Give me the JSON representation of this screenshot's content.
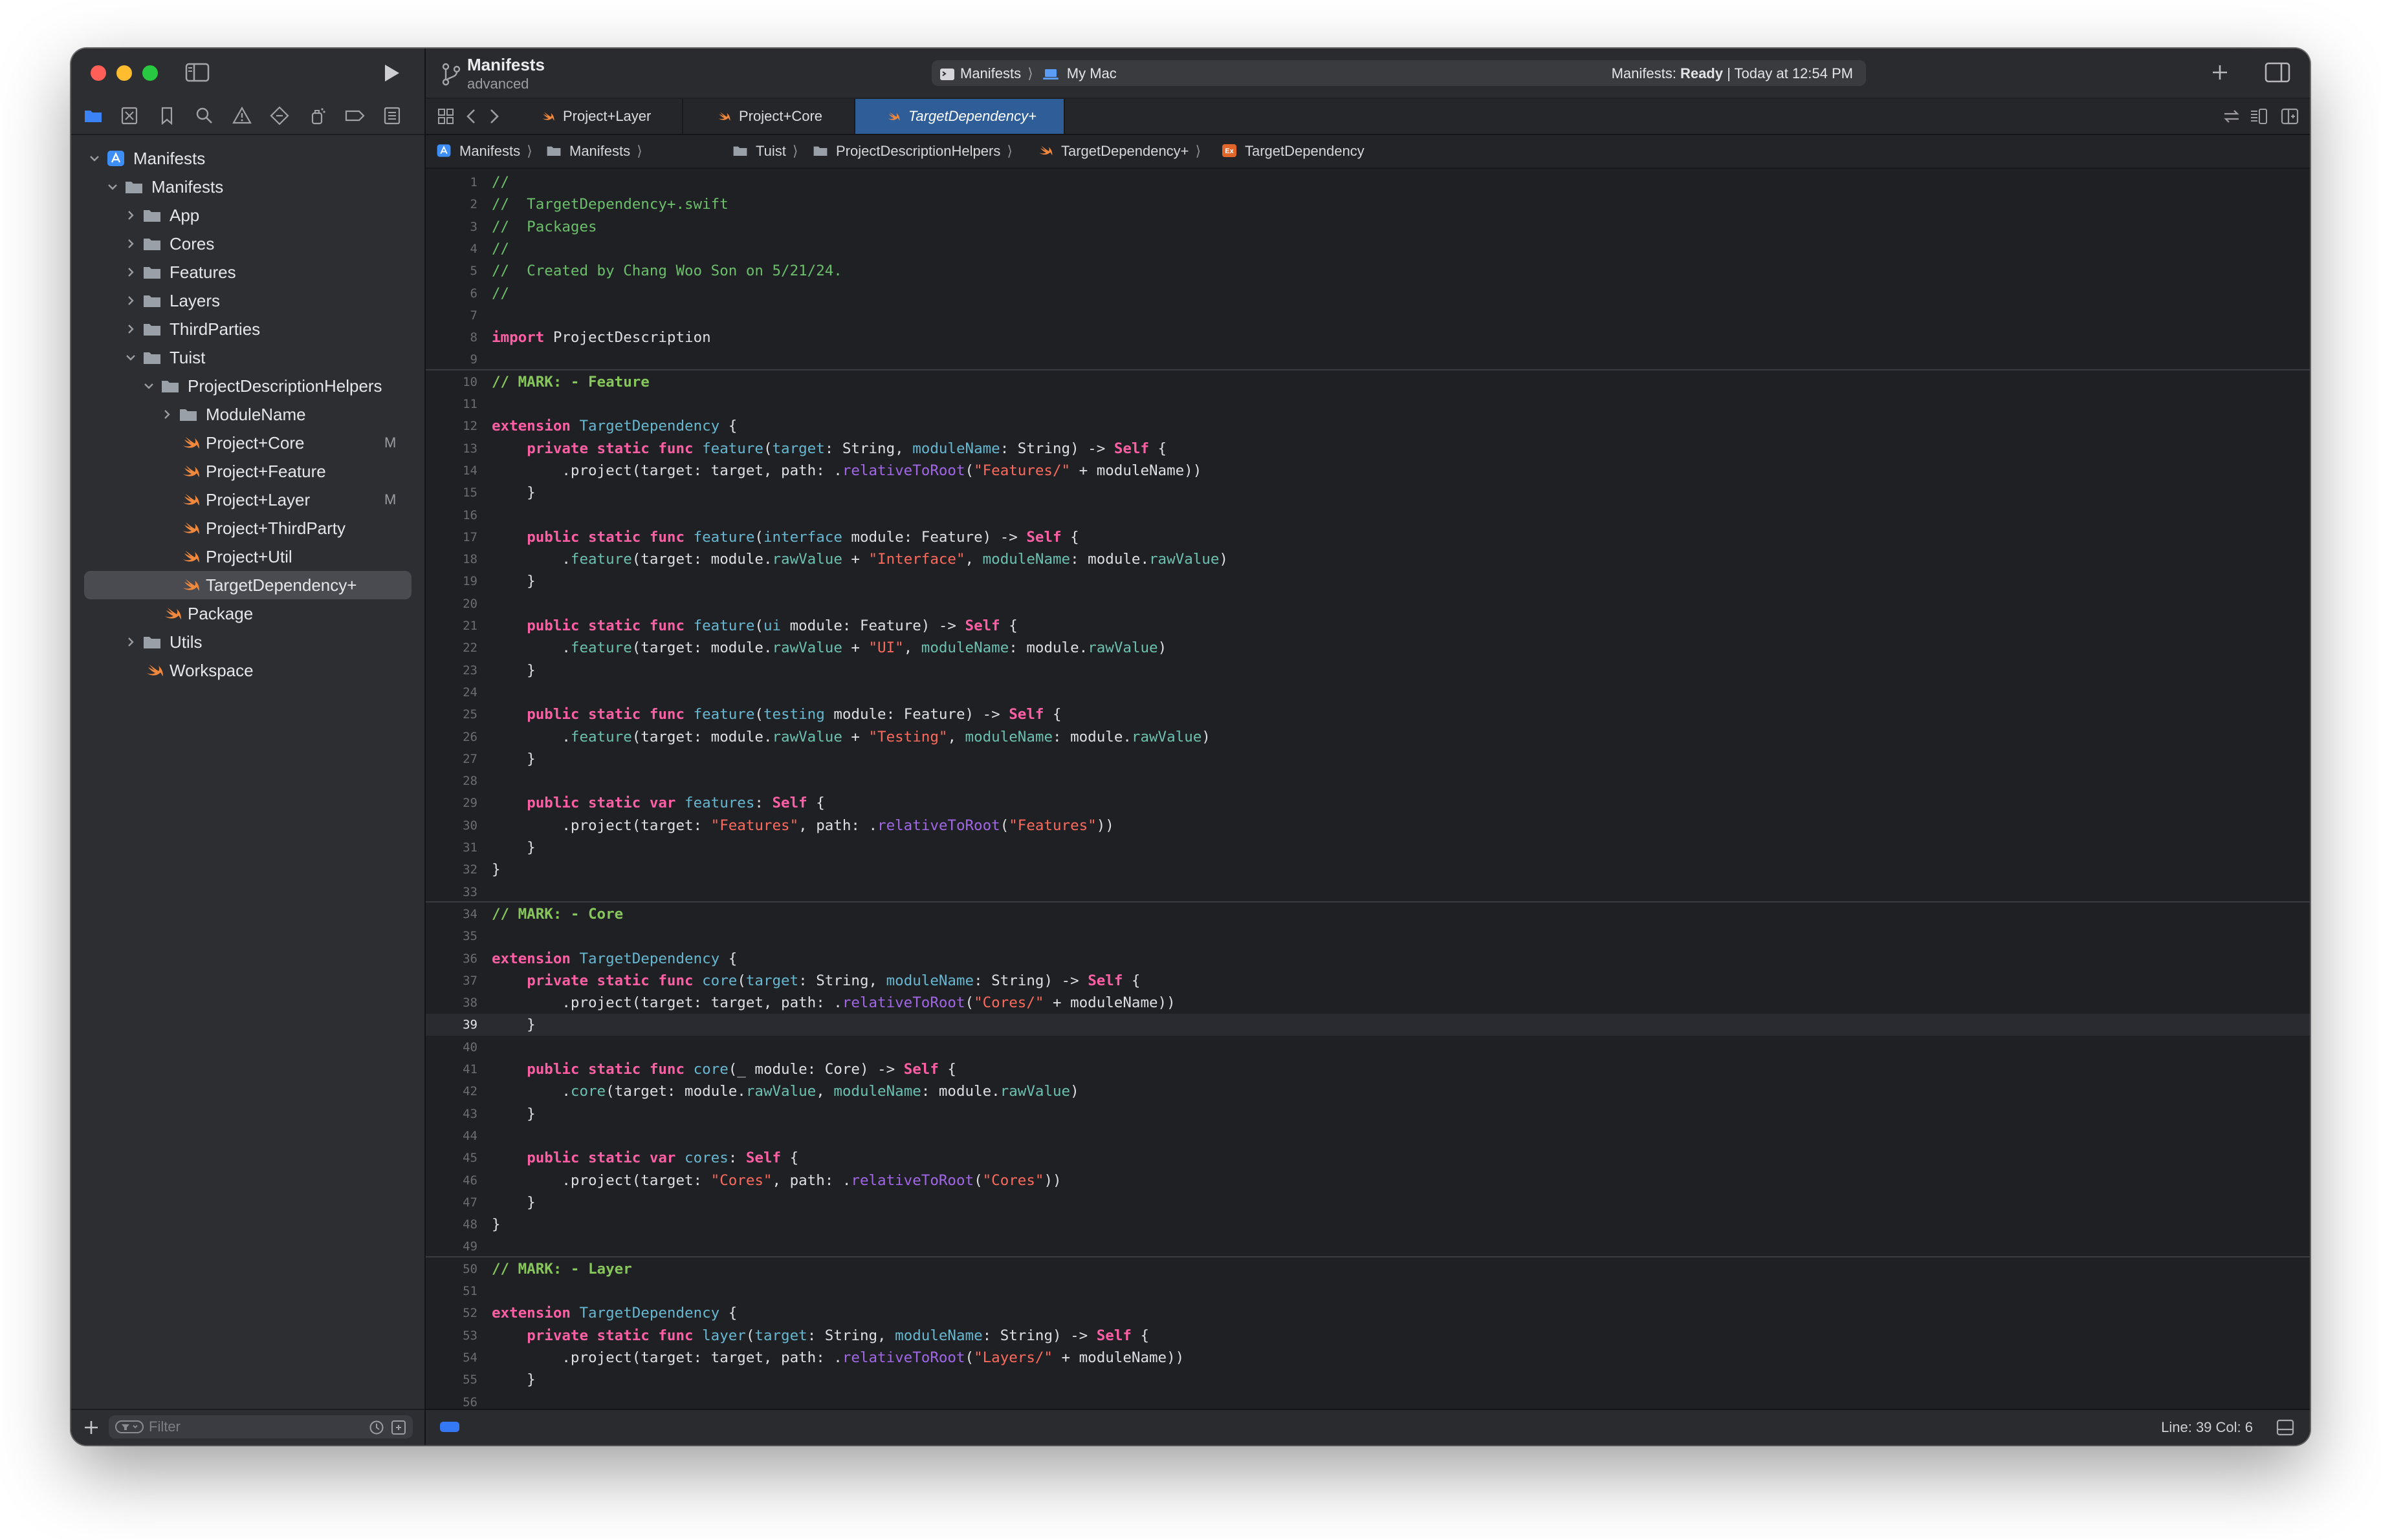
{
  "window": {
    "project_title": "Manifests",
    "project_subtitle": "advanced",
    "scheme": "Manifests",
    "destination": "My Mac",
    "status_prefix": "Manifests: ",
    "status_state": "Ready",
    "status_time": " | Today at 12:54 PM"
  },
  "tabs": [
    {
      "label": "Project+Layer"
    },
    {
      "label": "Project+Core"
    },
    {
      "label": "TargetDependency+"
    }
  ],
  "jumpbar": [
    "Manifests",
    "Manifests",
    "Tuist",
    "ProjectDescriptionHelpers",
    "TargetDependency+",
    "TargetDependency"
  ],
  "navigator": {
    "items": [
      {
        "label": "Manifests",
        "badge": ""
      },
      {
        "label": "Manifests",
        "badge": ""
      },
      {
        "label": "App",
        "badge": ""
      },
      {
        "label": "Cores",
        "badge": ""
      },
      {
        "label": "Features",
        "badge": ""
      },
      {
        "label": "Layers",
        "badge": ""
      },
      {
        "label": "ThirdParties",
        "badge": ""
      },
      {
        "label": "Tuist",
        "badge": ""
      },
      {
        "label": "ProjectDescriptionHelpers",
        "badge": ""
      },
      {
        "label": "ModuleName",
        "badge": ""
      },
      {
        "label": "Project+Core",
        "badge": "M"
      },
      {
        "label": "Project+Feature",
        "badge": ""
      },
      {
        "label": "Project+Layer",
        "badge": "M"
      },
      {
        "label": "Project+ThirdParty",
        "badge": ""
      },
      {
        "label": "Project+Util",
        "badge": ""
      },
      {
        "label": "TargetDependency+",
        "badge": ""
      },
      {
        "label": "Package",
        "badge": ""
      },
      {
        "label": "Utils",
        "badge": ""
      },
      {
        "label": "Workspace",
        "badge": ""
      }
    ],
    "filter_placeholder": "Filter"
  },
  "editor": {
    "lines": [
      {
        "n": "1",
        "t": [
          [
            "com",
            "//"
          ]
        ]
      },
      {
        "n": "2",
        "t": [
          [
            "com",
            "//  TargetDependency+.swift"
          ]
        ]
      },
      {
        "n": "3",
        "t": [
          [
            "com",
            "//  Packages"
          ]
        ]
      },
      {
        "n": "4",
        "t": [
          [
            "com",
            "//"
          ]
        ]
      },
      {
        "n": "5",
        "t": [
          [
            "com",
            "//  Created by Chang Woo Son on 5/21/24."
          ]
        ]
      },
      {
        "n": "6",
        "t": [
          [
            "com",
            "//"
          ]
        ]
      },
      {
        "n": "7",
        "t": []
      },
      {
        "n": "8",
        "t": [
          [
            "kw",
            "import"
          ],
          [
            "plain",
            " ProjectDescription"
          ]
        ]
      },
      {
        "n": "9",
        "t": []
      },
      {
        "n": "10",
        "mark": true,
        "t": [
          [
            "mark",
            "// MARK: - Feature"
          ]
        ]
      },
      {
        "n": "11",
        "t": []
      },
      {
        "n": "12",
        "t": [
          [
            "kw",
            "extension"
          ],
          [
            "plain",
            " "
          ],
          [
            "type",
            "TargetDependency"
          ],
          [
            "plain",
            " {"
          ]
        ]
      },
      {
        "n": "13",
        "t": [
          [
            "plain",
            "    "
          ],
          [
            "kw",
            "private static func"
          ],
          [
            "plain",
            " "
          ],
          [
            "fn",
            "feature"
          ],
          [
            "plain",
            "("
          ],
          [
            "param",
            "target"
          ],
          [
            "plain",
            ": String, "
          ],
          [
            "param",
            "moduleName"
          ],
          [
            "plain",
            ": String) -> "
          ],
          [
            "kw",
            "Self"
          ],
          [
            "plain",
            " {"
          ]
        ]
      },
      {
        "n": "14",
        "t": [
          [
            "plain",
            "        .project(target: target, path: ."
          ],
          [
            "call",
            "relativeToRoot"
          ],
          [
            "plain",
            "("
          ],
          [
            "str",
            "\"Features/\""
          ],
          [
            "plain",
            " + moduleName))"
          ]
        ]
      },
      {
        "n": "15",
        "t": [
          [
            "plain",
            "    }"
          ]
        ]
      },
      {
        "n": "16",
        "t": []
      },
      {
        "n": "17",
        "t": [
          [
            "plain",
            "    "
          ],
          [
            "kw",
            "public static func"
          ],
          [
            "plain",
            " "
          ],
          [
            "fn",
            "feature"
          ],
          [
            "plain",
            "("
          ],
          [
            "param",
            "interface"
          ],
          [
            "plain",
            " module: Feature) -> "
          ],
          [
            "kw",
            "Self"
          ],
          [
            "plain",
            " {"
          ]
        ]
      },
      {
        "n": "18",
        "t": [
          [
            "plain",
            "        ."
          ],
          [
            "prop",
            "feature"
          ],
          [
            "plain",
            "(target: module."
          ],
          [
            "prop",
            "rawValue"
          ],
          [
            "plain",
            " + "
          ],
          [
            "str",
            "\"Interface\""
          ],
          [
            "plain",
            ", "
          ],
          [
            "prop",
            "moduleName"
          ],
          [
            "plain",
            ": module."
          ],
          [
            "prop",
            "rawValue"
          ],
          [
            "plain",
            ")"
          ]
        ]
      },
      {
        "n": "19",
        "t": [
          [
            "plain",
            "    }"
          ]
        ]
      },
      {
        "n": "20",
        "t": []
      },
      {
        "n": "21",
        "t": [
          [
            "plain",
            "    "
          ],
          [
            "kw",
            "public static func"
          ],
          [
            "plain",
            " "
          ],
          [
            "fn",
            "feature"
          ],
          [
            "plain",
            "("
          ],
          [
            "param",
            "ui"
          ],
          [
            "plain",
            " module: Feature) -> "
          ],
          [
            "kw",
            "Self"
          ],
          [
            "plain",
            " {"
          ]
        ]
      },
      {
        "n": "22",
        "t": [
          [
            "plain",
            "        ."
          ],
          [
            "prop",
            "feature"
          ],
          [
            "plain",
            "(target: module."
          ],
          [
            "prop",
            "rawValue"
          ],
          [
            "plain",
            " + "
          ],
          [
            "str",
            "\"UI\""
          ],
          [
            "plain",
            ", "
          ],
          [
            "prop",
            "moduleName"
          ],
          [
            "plain",
            ": module."
          ],
          [
            "prop",
            "rawValue"
          ],
          [
            "plain",
            ")"
          ]
        ]
      },
      {
        "n": "23",
        "t": [
          [
            "plain",
            "    }"
          ]
        ]
      },
      {
        "n": "24",
        "t": []
      },
      {
        "n": "25",
        "t": [
          [
            "plain",
            "    "
          ],
          [
            "kw",
            "public static func"
          ],
          [
            "plain",
            " "
          ],
          [
            "fn",
            "feature"
          ],
          [
            "plain",
            "("
          ],
          [
            "param",
            "testing"
          ],
          [
            "plain",
            " module: Feature) -> "
          ],
          [
            "kw",
            "Self"
          ],
          [
            "plain",
            " {"
          ]
        ]
      },
      {
        "n": "26",
        "t": [
          [
            "plain",
            "        ."
          ],
          [
            "prop",
            "feature"
          ],
          [
            "plain",
            "(target: module."
          ],
          [
            "prop",
            "rawValue"
          ],
          [
            "plain",
            " + "
          ],
          [
            "str",
            "\"Testing\""
          ],
          [
            "plain",
            ", "
          ],
          [
            "prop",
            "moduleName"
          ],
          [
            "plain",
            ": module."
          ],
          [
            "prop",
            "rawValue"
          ],
          [
            "plain",
            ")"
          ]
        ]
      },
      {
        "n": "27",
        "t": [
          [
            "plain",
            "    }"
          ]
        ]
      },
      {
        "n": "28",
        "t": []
      },
      {
        "n": "29",
        "t": [
          [
            "plain",
            "    "
          ],
          [
            "kw",
            "public static var"
          ],
          [
            "plain",
            " "
          ],
          [
            "fn",
            "features"
          ],
          [
            "plain",
            ": "
          ],
          [
            "kw",
            "Self"
          ],
          [
            "plain",
            " {"
          ]
        ]
      },
      {
        "n": "30",
        "t": [
          [
            "plain",
            "        .project(target: "
          ],
          [
            "str",
            "\"Features\""
          ],
          [
            "plain",
            ", path: ."
          ],
          [
            "call",
            "relativeToRoot"
          ],
          [
            "plain",
            "("
          ],
          [
            "str",
            "\"Features\""
          ],
          [
            "plain",
            "))"
          ]
        ]
      },
      {
        "n": "31",
        "t": [
          [
            "plain",
            "    }"
          ]
        ]
      },
      {
        "n": "32",
        "t": [
          [
            "plain",
            "}"
          ]
        ]
      },
      {
        "n": "33",
        "t": []
      },
      {
        "n": "34",
        "mark": true,
        "t": [
          [
            "mark",
            "// MARK: - Core"
          ]
        ]
      },
      {
        "n": "35",
        "t": []
      },
      {
        "n": "36",
        "t": [
          [
            "kw",
            "extension"
          ],
          [
            "plain",
            " "
          ],
          [
            "type",
            "TargetDependency"
          ],
          [
            "plain",
            " {"
          ]
        ]
      },
      {
        "n": "37",
        "t": [
          [
            "plain",
            "    "
          ],
          [
            "kw",
            "private static func"
          ],
          [
            "plain",
            " "
          ],
          [
            "fn",
            "core"
          ],
          [
            "plain",
            "("
          ],
          [
            "param",
            "target"
          ],
          [
            "plain",
            ": String, "
          ],
          [
            "param",
            "moduleName"
          ],
          [
            "plain",
            ": String) -> "
          ],
          [
            "kw",
            "Self"
          ],
          [
            "plain",
            " {"
          ]
        ]
      },
      {
        "n": "38",
        "t": [
          [
            "plain",
            "        .project(target: target, path: ."
          ],
          [
            "call",
            "relativeToRoot"
          ],
          [
            "plain",
            "("
          ],
          [
            "str",
            "\"Cores/\""
          ],
          [
            "plain",
            " + moduleName))"
          ]
        ]
      },
      {
        "n": "39",
        "cur": true,
        "t": [
          [
            "plain",
            "    }"
          ]
        ]
      },
      {
        "n": "40",
        "t": []
      },
      {
        "n": "41",
        "t": [
          [
            "plain",
            "    "
          ],
          [
            "kw",
            "public static func"
          ],
          [
            "plain",
            " "
          ],
          [
            "fn",
            "core"
          ],
          [
            "plain",
            "(_ module: Core) -> "
          ],
          [
            "kw",
            "Self"
          ],
          [
            "plain",
            " {"
          ]
        ]
      },
      {
        "n": "42",
        "t": [
          [
            "plain",
            "        ."
          ],
          [
            "prop",
            "core"
          ],
          [
            "plain",
            "(target: module."
          ],
          [
            "prop",
            "rawValue"
          ],
          [
            "plain",
            ", "
          ],
          [
            "prop",
            "moduleName"
          ],
          [
            "plain",
            ": module."
          ],
          [
            "prop",
            "rawValue"
          ],
          [
            "plain",
            ")"
          ]
        ]
      },
      {
        "n": "43",
        "t": [
          [
            "plain",
            "    }"
          ]
        ]
      },
      {
        "n": "44",
        "t": []
      },
      {
        "n": "45",
        "t": [
          [
            "plain",
            "    "
          ],
          [
            "kw",
            "public static var"
          ],
          [
            "plain",
            " "
          ],
          [
            "fn",
            "cores"
          ],
          [
            "plain",
            ": "
          ],
          [
            "kw",
            "Self"
          ],
          [
            "plain",
            " {"
          ]
        ]
      },
      {
        "n": "46",
        "t": [
          [
            "plain",
            "        .project(target: "
          ],
          [
            "str",
            "\"Cores\""
          ],
          [
            "plain",
            ", path: ."
          ],
          [
            "call",
            "relativeToRoot"
          ],
          [
            "plain",
            "("
          ],
          [
            "str",
            "\"Cores\""
          ],
          [
            "plain",
            "))"
          ]
        ]
      },
      {
        "n": "47",
        "t": [
          [
            "plain",
            "    }"
          ]
        ]
      },
      {
        "n": "48",
        "t": [
          [
            "plain",
            "}"
          ]
        ]
      },
      {
        "n": "49",
        "t": []
      },
      {
        "n": "50",
        "mark": true,
        "t": [
          [
            "mark",
            "// MARK: - Layer"
          ]
        ]
      },
      {
        "n": "51",
        "t": []
      },
      {
        "n": "52",
        "t": [
          [
            "kw",
            "extension"
          ],
          [
            "plain",
            " "
          ],
          [
            "type",
            "TargetDependency"
          ],
          [
            "plain",
            " {"
          ]
        ]
      },
      {
        "n": "53",
        "t": [
          [
            "plain",
            "    "
          ],
          [
            "kw",
            "private static func"
          ],
          [
            "plain",
            " "
          ],
          [
            "fn",
            "layer"
          ],
          [
            "plain",
            "("
          ],
          [
            "param",
            "target"
          ],
          [
            "plain",
            ": String, "
          ],
          [
            "param",
            "moduleName"
          ],
          [
            "plain",
            ": String) -> "
          ],
          [
            "kw",
            "Self"
          ],
          [
            "plain",
            " {"
          ]
        ]
      },
      {
        "n": "54",
        "t": [
          [
            "plain",
            "        .project(target: target, path: ."
          ],
          [
            "call",
            "relativeToRoot"
          ],
          [
            "plain",
            "("
          ],
          [
            "str",
            "\"Layers/\""
          ],
          [
            "plain",
            " + moduleName))"
          ]
        ]
      },
      {
        "n": "55",
        "t": [
          [
            "plain",
            "    }"
          ]
        ]
      },
      {
        "n": "56",
        "t": []
      }
    ]
  },
  "statusbar": {
    "position": "Line: 39  Col: 6"
  }
}
